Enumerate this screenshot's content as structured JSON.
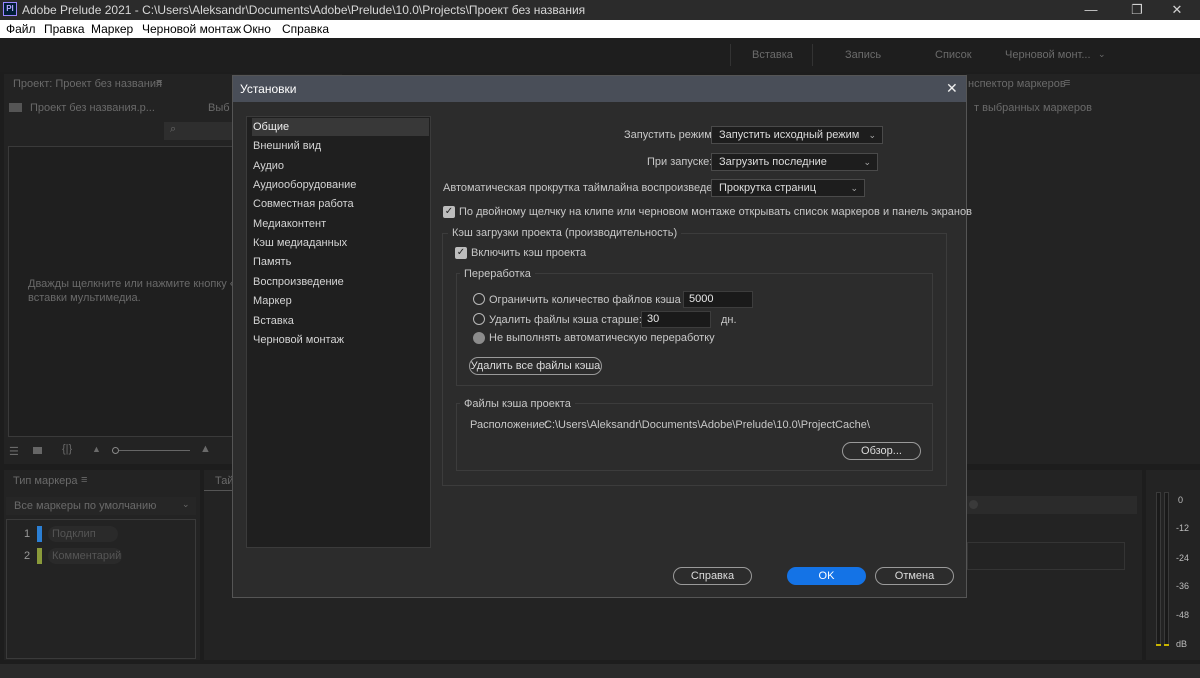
{
  "titlebar": {
    "logo": "Pl",
    "title": "Adobe Prelude 2021 - C:\\Users\\Aleksandr\\Documents\\Adobe\\Prelude\\10.0\\Projects\\Проект без названия",
    "minimize": "—",
    "restore": "❐",
    "close": "✕"
  },
  "menubar": {
    "items": [
      "Файл",
      "Правка",
      "Маркер",
      "Черновой монтаж",
      "Окно",
      "Справка"
    ]
  },
  "workspace": {
    "tabs": [
      "Вставка",
      "Запись",
      "Список",
      "Черновой монт..."
    ]
  },
  "project_panel": {
    "title": "Проект: Проект без названия",
    "item": "Проект без названия.p...",
    "col2": "Выб",
    "empty_hint_line1": "Дважды щелкните или нажмите кнопку «Вс",
    "empty_hint_line2": "вставки мультимедиа."
  },
  "marker_inspector": {
    "title": "нспектор маркеров",
    "empty": "т выбранных маркеров"
  },
  "marker_type_panel": {
    "title": "Тип маркера",
    "dropdown": "Все маркеры по умолчанию",
    "markers": [
      {
        "num": "1",
        "name": "Подклип",
        "color": "#2b7fd4"
      },
      {
        "num": "2",
        "name": "Комментарий",
        "color": "#8a9a3a"
      }
    ],
    "tab_fragment": "Тай"
  },
  "vu_meter": {
    "labels": [
      "0",
      "-12",
      "-24",
      "-36",
      "-48",
      "dB"
    ]
  },
  "dialog": {
    "title": "Установки",
    "close": "✕",
    "nav": [
      "Общие",
      "Внешний вид",
      "Аудио",
      "Аудиооборудование",
      "Совместная работа",
      "Медиаконтент",
      "Кэш медиаданных",
      "Память",
      "Воспроизведение",
      "Маркер",
      "Вставка",
      "Черновой монтаж"
    ],
    "selected_nav": "Общие",
    "startup_mode_label": "Запустить режим:",
    "startup_mode_value": "Запустить исходный режим",
    "on_start_label": "При запуске:",
    "on_start_value": "Загрузить последние",
    "autoscroll_label": "Автоматическая прокрутка таймлайна воспроизведения:",
    "autoscroll_value": "Прокрутка страниц",
    "dblclick_checkbox": "По двойному щелчку на клипе или черновом монтаже открывать список маркеров и панель экранов",
    "cache_group": "Кэш загрузки проекта (производительность)",
    "enable_cache": "Включить кэш проекта",
    "processing_group": "Переработка",
    "limit_files_label": "Ограничить количество файлов кэша до",
    "limit_files_value": "5000",
    "delete_older_label": "Удалить файлы кэша старше:",
    "delete_older_value": "30",
    "days_unit": "дн.",
    "no_auto_label": "Не выполнять автоматическую переработку",
    "delete_all_button": "Удалить все файлы кэша",
    "cache_files_group": "Файлы кэша проекта",
    "location_label": "Расположение:",
    "location_path": "C:\\Users\\Aleksandr\\Documents\\Adobe\\Prelude\\10.0\\ProjectCache\\",
    "browse_button": "Обзор...",
    "help_button": "Справка",
    "ok_button": "OK",
    "cancel_button": "Отмена"
  },
  "colors": {
    "accent": "#1473e6",
    "dialog_header": "#494e58",
    "background": "#1d1d1d"
  }
}
